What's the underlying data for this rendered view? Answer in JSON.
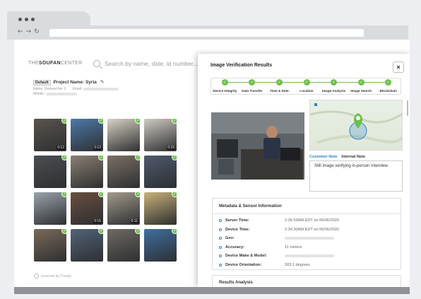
{
  "app": {
    "logo_prefix": "THE",
    "logo_name": "SOUFAN",
    "logo_suffix": "CENTER",
    "search_placeholder": "Search by name, date, id number...",
    "project_badge": "Default",
    "project_name": "Project Name: Syria",
    "name_label": "Name: Researcher 3",
    "email_label": "Email:",
    "mobile_label": "Mobile:",
    "powered_by": "powered by Truepic"
  },
  "thumbnails": [
    {
      "duration": "0:12",
      "tone": "#5a544c"
    },
    {
      "duration": "0:12",
      "tone": "#4d79a8"
    },
    {
      "duration": "",
      "tone": "#d8d2c4"
    },
    {
      "duration": "0:10",
      "tone": "#cfcbc2"
    },
    {
      "duration": "",
      "tone": "#4a4f52"
    },
    {
      "duration": "",
      "tone": "#8a8071"
    },
    {
      "duration": "",
      "tone": "#7a7066"
    },
    {
      "duration": "",
      "tone": "#4e5a6e"
    },
    {
      "duration": "",
      "tone": "#9aa3aa"
    },
    {
      "duration": "0:15",
      "tone": "#6a4e3e"
    },
    {
      "duration": "0:11",
      "tone": "#a39a8a"
    },
    {
      "duration": "",
      "tone": "#c9b27a"
    },
    {
      "duration": "",
      "tone": "#7b6a58"
    },
    {
      "duration": "",
      "tone": "#52637a"
    },
    {
      "duration": "",
      "tone": "#6f6a64"
    },
    {
      "duration": "",
      "tone": "#3f6fa0"
    }
  ],
  "modal": {
    "title": "Image Verification Results",
    "close": "×",
    "steps": [
      "Device Integrity",
      "Data Transfer",
      "Time & Date",
      "Location",
      "Image Analysis",
      "Image Search",
      "Blockchain"
    ],
    "customer_note_tab": "Customer Note",
    "internal_note_tab": "Internal Note",
    "note_text": "Still image verifying in-person interview.",
    "metadata_title": "Metadata & Sensor Information",
    "metadata": [
      {
        "label": "Server Time:",
        "value": "2:36:53AM EDT on 06/06/2020"
      },
      {
        "label": "Device Time:",
        "value": "2:34:30AM EDT on 06/06/2020"
      },
      {
        "label": "Geo:",
        "value": ""
      },
      {
        "label": "Accuracy:",
        "value": "11 meters"
      },
      {
        "label": "Device Make & Model:",
        "value": ""
      },
      {
        "label": "Device Orientation:",
        "value": "303.1 degrees"
      }
    ],
    "results_title": "Results Analysis"
  },
  "colors": {
    "accent_green": "#6cc04a",
    "accent_blue": "#2e84c8"
  }
}
